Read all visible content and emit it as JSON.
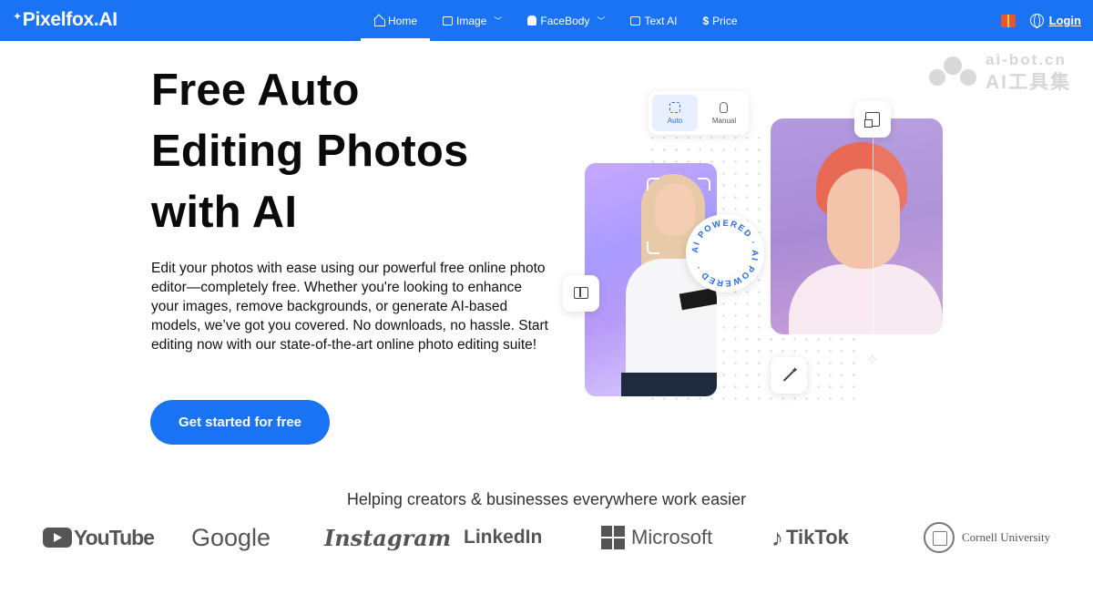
{
  "nav": {
    "logo": "Pixelfox.AI",
    "items": [
      {
        "label": "Home",
        "icon": "home-icon",
        "dropdown": false,
        "active": true
      },
      {
        "label": "Image",
        "icon": "image-icon",
        "dropdown": true,
        "active": false
      },
      {
        "label": "FaceBody",
        "icon": "face-icon",
        "dropdown": true,
        "active": false
      },
      {
        "label": "Text AI",
        "icon": "text-ai-icon",
        "dropdown": false,
        "active": false
      },
      {
        "label": "Price",
        "icon": "dollar-icon",
        "dropdown": false,
        "active": false
      }
    ],
    "login": "Login",
    "brand_color": "#1a73f5"
  },
  "hero": {
    "title_line1": "Free Auto",
    "title_line2": "Editing Photos",
    "title_line3": "with AI",
    "description": "Edit your photos with ease using our powerful free online photo editor—completely free. Whether you're looking to enhance your images, remove backgrounds, or generate AI-based models, we’ve got you covered. No downloads, no hassle. Start editing now with our state-of-the-art online photo editing suite!",
    "cta": "Get started for free"
  },
  "illustration": {
    "mode_auto": "Auto",
    "mode_manual": "Manual",
    "badge_text": "AI POWERED · AI POWERED ·"
  },
  "watermark": {
    "line1": "ai-bot.cn",
    "line2": "AI工具集"
  },
  "trust": {
    "heading": "Helping creators & businesses everywhere work easier",
    "logos": [
      "YouTube",
      "Google",
      "Instagram",
      "LinkedIn",
      "Microsoft",
      "TikTok",
      "Cornell University"
    ]
  }
}
